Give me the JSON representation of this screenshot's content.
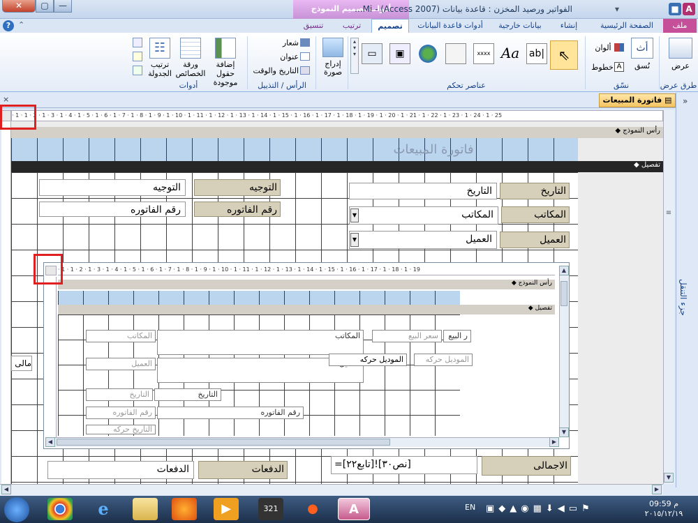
{
  "window": {
    "title": "الفواتير ورصيد المخزن : قاعدة بيانات (Access 2007) - Mi...",
    "context_group": "أدوات تصميم النموذج",
    "close_glyph": "✕",
    "max_glyph": "▢",
    "min_glyph": "—"
  },
  "tabs": {
    "file": "ملف",
    "home": "الصفحة الرئيسية",
    "create": "إنشاء",
    "external": "بيانات خارجية",
    "dbtools": "أدوات قاعدة البيانات",
    "design": "تصميم",
    "arrange": "ترتيب",
    "format": "تنسيق"
  },
  "ribbon": {
    "views_label": "عرض",
    "views_group": "طرق عرض",
    "theme_label": "نُسق",
    "colors_label": "ألوان",
    "fonts_label": "خطوط",
    "themes_group": "نسّق",
    "controls_group": "عناصر تحكم",
    "insert_image": "إدراج صورة",
    "logo": "شعار",
    "title": "عنوان",
    "datetime": "التاريخ والوقت",
    "header_footer_group": "الرأس / التذييل",
    "add_fields": "إضافة حقول موجودة",
    "property_sheet": "ورقة الخصائص",
    "tab_order": "ترتيب الجدولة",
    "tools_group": "أدوات"
  },
  "document": {
    "tab_title": "فاتورة المبيعات",
    "nav_pane_label": "جزء التنقل"
  },
  "form": {
    "header_section": "رأس النموذج",
    "detail_section": "تفصيل",
    "form_title": "فاتورة المبيعات",
    "fields": {
      "date_label": "التاريخ",
      "date_value": "التاريخ",
      "offices_label": "المكاتب",
      "offices_value": "المكاتب",
      "customer_label": "العميل",
      "customer_value": "العميل",
      "direction_label": "التوجيه",
      "direction_value": "التوجيه",
      "invoice_label": "رقم الفاتوره",
      "invoice_value": "رقم الفاتوره",
      "total_label": "الاجمالى",
      "total_value": "=[تابع٢٢]![نص٣٠]",
      "payments_label": "الدفعات",
      "payments_value": "الدفعات",
      "left_cut_label": "مالى"
    }
  },
  "subform": {
    "header_section": "رأس النموذج",
    "detail_section": "تفصيل",
    "fields": {
      "offices_value": "المكاتب",
      "offices_label": "المكاتب",
      "customer_value": "العميل",
      "customer_label": "العميل",
      "sale_price_label": "سعر البيع",
      "sale_price_value": "ر البيع",
      "model_label": "الموديل حركه",
      "model_value": "الموديل حركه",
      "date_value": "التاريخ",
      "date_label": "التاريخ",
      "invoice_value": "رقم الفاتوره",
      "invoice_label": "رقم الفاتوره",
      "cut_label": "التاريخ حركه"
    }
  },
  "taskbar": {
    "lang": "EN",
    "time": "09:59 م",
    "date": "٢٠١٥/١٢/١٩"
  },
  "colors": {
    "accent": "#c64f9a",
    "ribbon_blue": "#15428b",
    "label_bg": "#d6cfb9",
    "header_band": "#bcd5ef"
  }
}
